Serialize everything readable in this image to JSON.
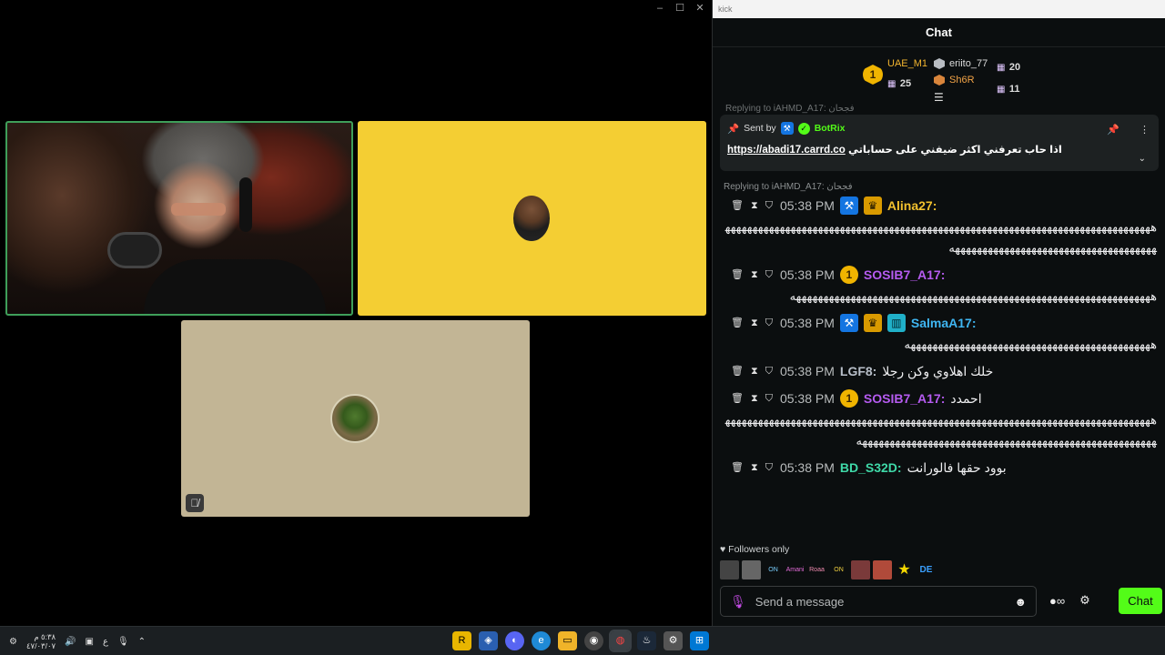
{
  "video": {
    "window_controls": [
      "–",
      "☐",
      "✕"
    ]
  },
  "chat": {
    "window_title": "kick",
    "header_title": "Chat",
    "leaderboard": {
      "first": {
        "rank": "1",
        "name": "UAE_M1",
        "count": "25"
      },
      "second": {
        "name": "eriito_77",
        "count": "20"
      },
      "third": {
        "name": "Sh6R",
        "count": "11"
      }
    },
    "reply_peek": "Replying to iAHMD_A17: فجحان",
    "pinned": {
      "sent_by_label": "Sent by",
      "sender": "BotRix",
      "message_text": "اذا حاب تعرفني اكثر ضيفني على حساباتي",
      "link": "https://abadi17.carrd.co"
    },
    "messages": [
      {
        "reply": "Replying to iAHMD_A17: فجحان",
        "time": "05:38 PM",
        "user": "Alina27:",
        "user_color": "#f2c12e",
        "text": "ههههههههههههههههههههههههههههههههههههههههههههههههههههههههههههههههههههههههههههههههههههههههههههههههههههههههههههههههههههه"
      },
      {
        "time": "05:38 PM",
        "user": "SOSIB7_A17:",
        "user_color": "#b55bf0",
        "badge": "1",
        "text": "ههههههههههههههههههههههههههههههههههههههههههههههههههههههههههههههههههه"
      },
      {
        "time": "05:38 PM",
        "user": "SalmaA17:",
        "user_color": "#3fb6f2",
        "text": "هههههههههههههههههههههههههههههههههههههههههههههه"
      },
      {
        "time": "05:38 PM",
        "user": "LGF8:",
        "user_color": "#b8bfc9",
        "text": "خلك اهلاوي وكن رجلا"
      },
      {
        "time": "05:38 PM",
        "user": "SOSIB7_A17:",
        "user_color": "#b55bf0",
        "badge": "1",
        "text": "احمدد",
        "text2": "هههههههههههههههههههههههههههههههههههههههههههههههههههههههههههههههههههههههههههههههههههههههههههههههههههههههههههههههههههههههههههههههههههههه"
      },
      {
        "time": "05:38 PM",
        "user": "BD_S32D:",
        "user_color": "#3fd9a8",
        "text": "بوود حقها فالورانت"
      }
    ],
    "followers_label": "Followers only",
    "emotes": [
      "emote-1",
      "emote-2",
      "emote-ontop",
      "emote-amani",
      "emote-roaa",
      "emote-ontop2",
      "emote-7",
      "emote-8",
      "emote-star",
      "emote-9"
    ],
    "emote_texts": [
      "",
      "",
      "ON TOP",
      "Amani",
      "Roaa",
      "ON TOP",
      "",
      "",
      "★",
      "DE"
    ],
    "composer": {
      "placeholder": "Send a message"
    },
    "send_button": "Chat"
  },
  "taskbar": {
    "clock_time": "٥:٣٨ م",
    "clock_date": "٤٧/٠٣/٠٧",
    "lang": "ع"
  },
  "colors": {
    "kick_green": "#53fc18",
    "bg": "#0b0e0f"
  }
}
